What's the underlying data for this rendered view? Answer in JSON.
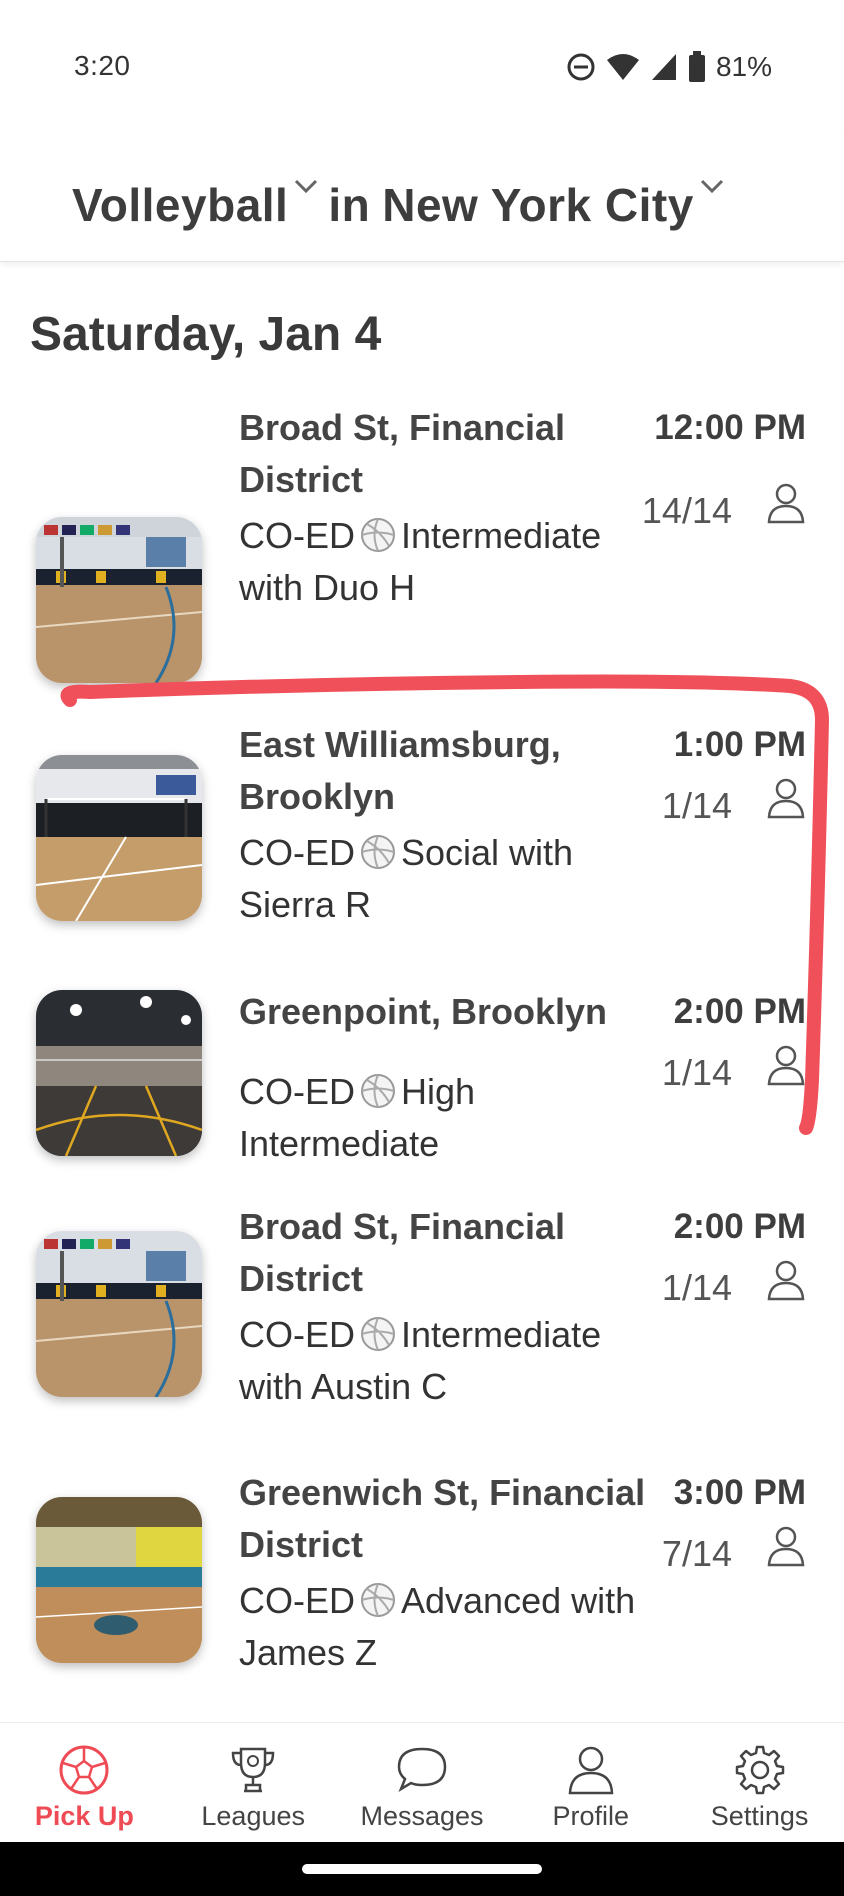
{
  "status_bar": {
    "time": "3:20",
    "battery": "81%"
  },
  "header": {
    "sport": "Volleyball",
    "connector": "in",
    "city": "New York City"
  },
  "date_heading": "Saturday, Jan 4",
  "events": [
    {
      "location": "Broad St, Financial District",
      "description_prefix": "CO-ED",
      "description": "Intermediate with Duo H",
      "time": "12:00 PM",
      "count": "14/14"
    },
    {
      "location": "East Williamsburg, Brooklyn",
      "description_prefix": "CO-ED",
      "description": "Social with Sierra R",
      "time": "1:00 PM",
      "count": "1/14"
    },
    {
      "location": "Greenpoint, Brooklyn",
      "description_prefix": "CO-ED",
      "description": "High Intermediate",
      "time": "2:00 PM",
      "count": "1/14"
    },
    {
      "location": "Broad St, Financial District",
      "description_prefix": "CO-ED",
      "description": "Intermediate with Austin C",
      "time": "2:00 PM",
      "count": "1/14"
    },
    {
      "location": "Greenwich St, Financial District",
      "description_prefix": "CO-ED",
      "description": "Advanced with James Z",
      "time": "3:00 PM",
      "count": "7/14"
    }
  ],
  "nav": {
    "items": [
      {
        "label": "Pick Up",
        "icon": "soccer-ball-icon",
        "active": true
      },
      {
        "label": "Leagues",
        "icon": "trophy-icon",
        "active": false
      },
      {
        "label": "Messages",
        "icon": "chat-bubble-icon",
        "active": false
      },
      {
        "label": "Profile",
        "icon": "person-icon",
        "active": false
      },
      {
        "label": "Settings",
        "icon": "gear-icon",
        "active": false
      }
    ]
  },
  "colors": {
    "accent": "#ef4b55",
    "annotation": "#f0505a",
    "text": "#3a3a3a"
  }
}
